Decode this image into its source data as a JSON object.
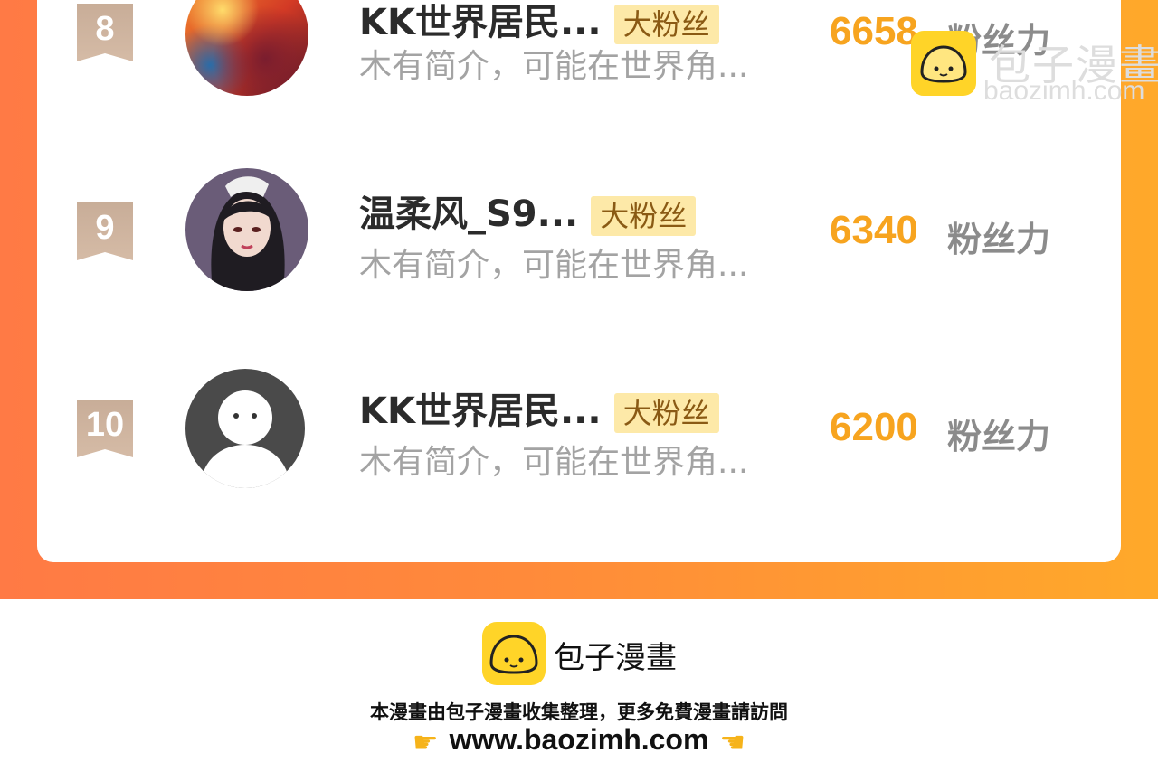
{
  "ranking": [
    {
      "rank": "8",
      "username": "KK世界居民...",
      "badge": "大粉丝",
      "bio": "木有简介，可能在世界角...",
      "score": "6658",
      "score_label": "粉丝力",
      "avatar": "galaxy-avatar"
    },
    {
      "rank": "9",
      "username": "温柔风_S9...",
      "badge": "大粉丝",
      "bio": "木有简介，可能在世界角...",
      "score": "6340",
      "score_label": "粉丝力",
      "avatar": "dark-hair-girl-avatar"
    },
    {
      "rank": "10",
      "username": "KK世界居民...",
      "badge": "大粉丝",
      "bio": "木有简介，可能在世界角...",
      "score": "6200",
      "score_label": "粉丝力",
      "avatar": "default-ghost-avatar"
    }
  ],
  "watermark": {
    "title": "包子漫畫",
    "domain": "baozimh.com",
    "icon": "bun-logo-icon"
  },
  "footer": {
    "brand": "包子漫畫",
    "text": "本漫畫由包子漫畫收集整理，更多免費漫畫請訪問",
    "url": "www.baozimh.com",
    "left_icon": "pointing-right-hand-icon",
    "right_icon": "pointing-left-hand-icon"
  },
  "colors": {
    "band_start": "#ff7a45",
    "band_end": "#ffa92a",
    "score": "#f7a41f",
    "badge_bg": "#fde9a8",
    "logo": "#ffd428"
  }
}
